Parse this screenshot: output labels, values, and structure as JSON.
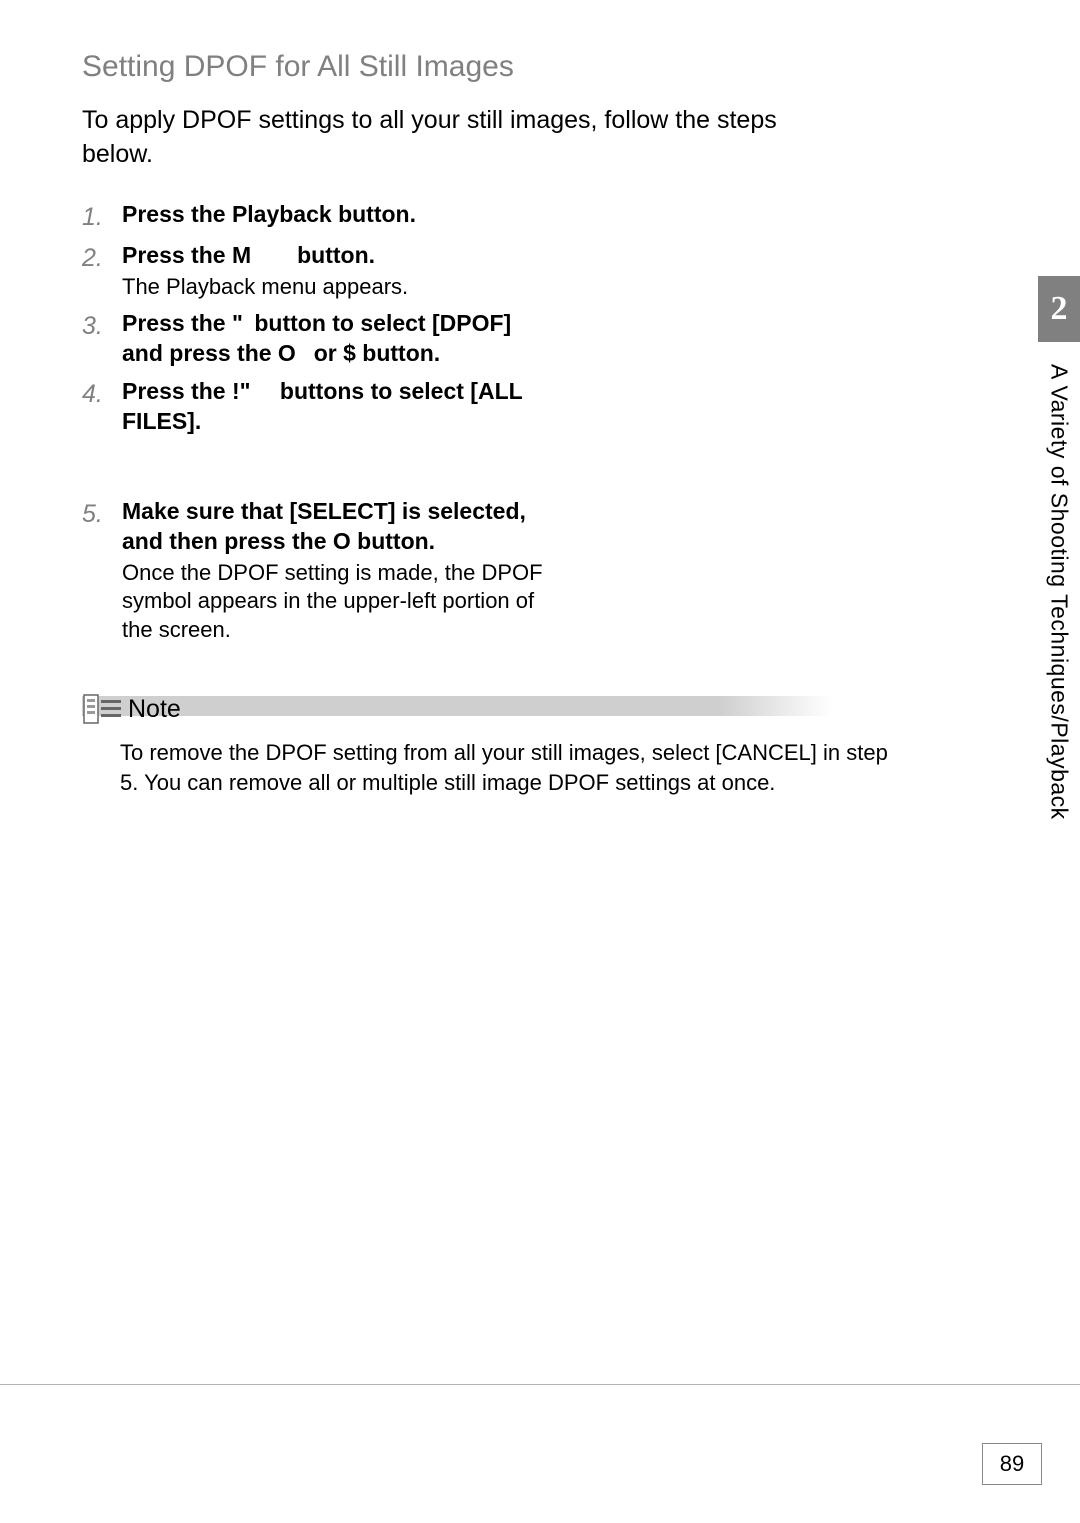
{
  "heading": "Setting DPOF for All Still Images",
  "intro": "To apply DPOF settings to all your still images, follow the steps below.",
  "steps": [
    {
      "num": "1.",
      "title": "Press the Playback button.",
      "desc": ""
    },
    {
      "num": "2.",
      "title": "Press the M  button.",
      "desc": "The Playback menu appears."
    },
    {
      "num": "3.",
      "title": "Press the \" button to select [DPOF] and press the O  or $ button.",
      "desc": ""
    },
    {
      "num": "4.",
      "title": "Press the !\"  buttons to select [ALL FILES].",
      "desc": ""
    },
    {
      "num": "5.",
      "title": "Make sure that [SELECT] is selected, and then press the O button.",
      "desc": "Once the DPOF setting is made, the DPOF symbol appears in the upper-left portion of the screen."
    }
  ],
  "note": {
    "label": "Note",
    "text": "To remove the DPOF setting from all your still images, select [CANCEL] in step 5. You can remove all or multiple still image DPOF settings at once."
  },
  "side": {
    "chapter": "2",
    "title": "A Variety of Shooting Techniques/Playback"
  },
  "page_number": "89"
}
